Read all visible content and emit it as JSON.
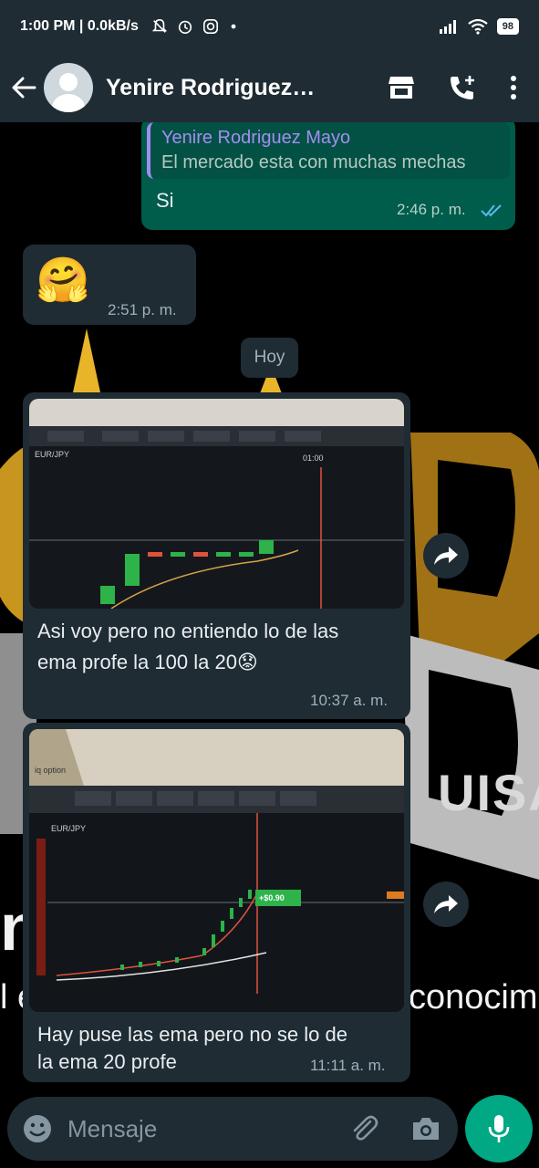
{
  "status_bar": {
    "time_speed": "1:00 PM | 0.0kB/s",
    "battery": "98"
  },
  "header": {
    "contact_name": "Yenire Rodriguez…"
  },
  "messages": [
    {
      "direction": "outgoing",
      "quote_author": "Yenire Rodriguez Mayo",
      "quote_text": "El mercado esta con muchas mechas",
      "text": "Si",
      "time": "2:46 p. m."
    },
    {
      "direction": "incoming",
      "text": "🤗",
      "time": "2:51 p. m."
    },
    {
      "direction": "incoming",
      "type": "image",
      "caption_line1": "Asi voy pero no entiendo lo de las",
      "caption_line2": "ema profe la 100 la 20😟",
      "time": "10:37 a. m."
    },
    {
      "direction": "incoming",
      "type": "image",
      "caption_line1": "Hay puse las ema pero no se lo de",
      "caption_line2": "la ema 20 profe",
      "time": "11:11 a. m."
    }
  ],
  "date_separator": "Hoy",
  "photo1": {
    "asset": "EUR/JPY",
    "clock": "01:00"
  },
  "photo2": {
    "brand": "iq option",
    "asset": "EUR/JPY",
    "tag": "+$0.90"
  },
  "wallpaper": {
    "big_text": "na         inar",
    "small_text_left": "l é",
    "small_text_right": "conocimie",
    "logo_letters": "UISA"
  },
  "composer": {
    "placeholder": "Mensaje"
  },
  "colors": {
    "outgoing": "#005c4b",
    "incoming": "#1f2c34",
    "accent": "#00a884",
    "quote_author": "#a58cf2",
    "read_ticks": "#53bdeb"
  }
}
